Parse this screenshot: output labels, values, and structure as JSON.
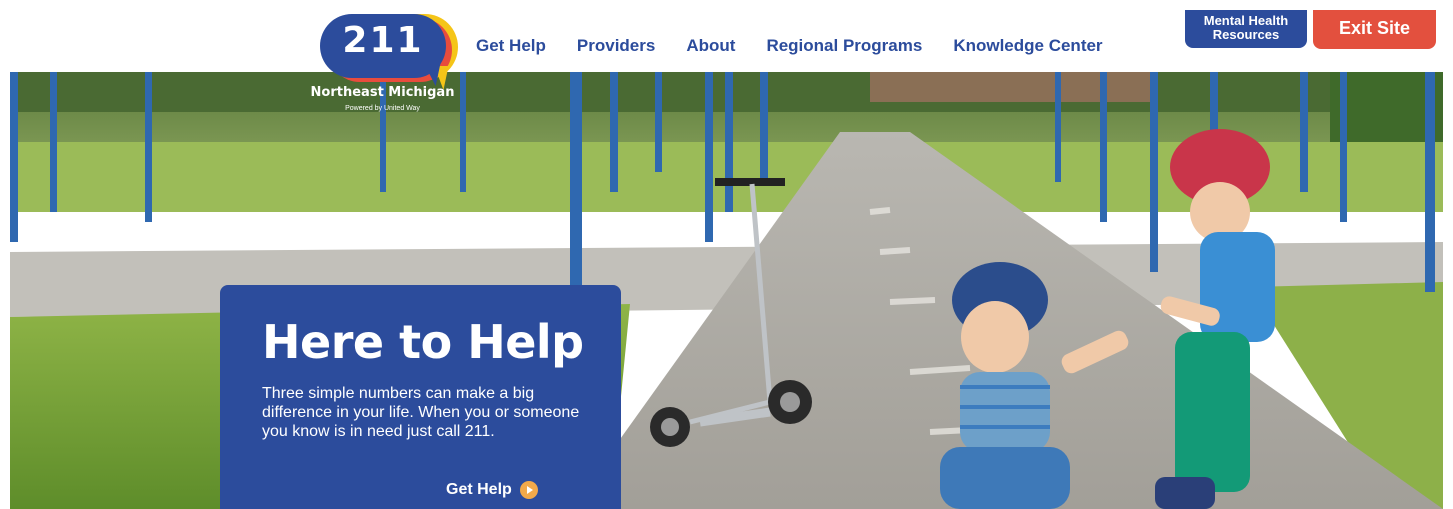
{
  "logo": {
    "number": "211",
    "region": "Northeast Michigan",
    "tagline": "Powered by United Way"
  },
  "nav": {
    "items": [
      {
        "label": "Get Help"
      },
      {
        "label": "Providers"
      },
      {
        "label": "About"
      },
      {
        "label": "Regional Programs"
      },
      {
        "label": "Knowledge Center"
      }
    ]
  },
  "utility": {
    "mental_health_label": "Mental Health Resources",
    "exit_label": "Exit Site"
  },
  "hero": {
    "title": "Here to Help",
    "body": "Three simple numbers can make a big difference in your life. When you or someone you know is in need just call 211.",
    "cta_label": "Get Help",
    "image_icon": "photo-children-scooter"
  },
  "colors": {
    "brand_blue": "#2c4c9c",
    "exit_red": "#e3503e",
    "accent_orange": "#f2a94a",
    "accent_yellow": "#f5c518"
  }
}
